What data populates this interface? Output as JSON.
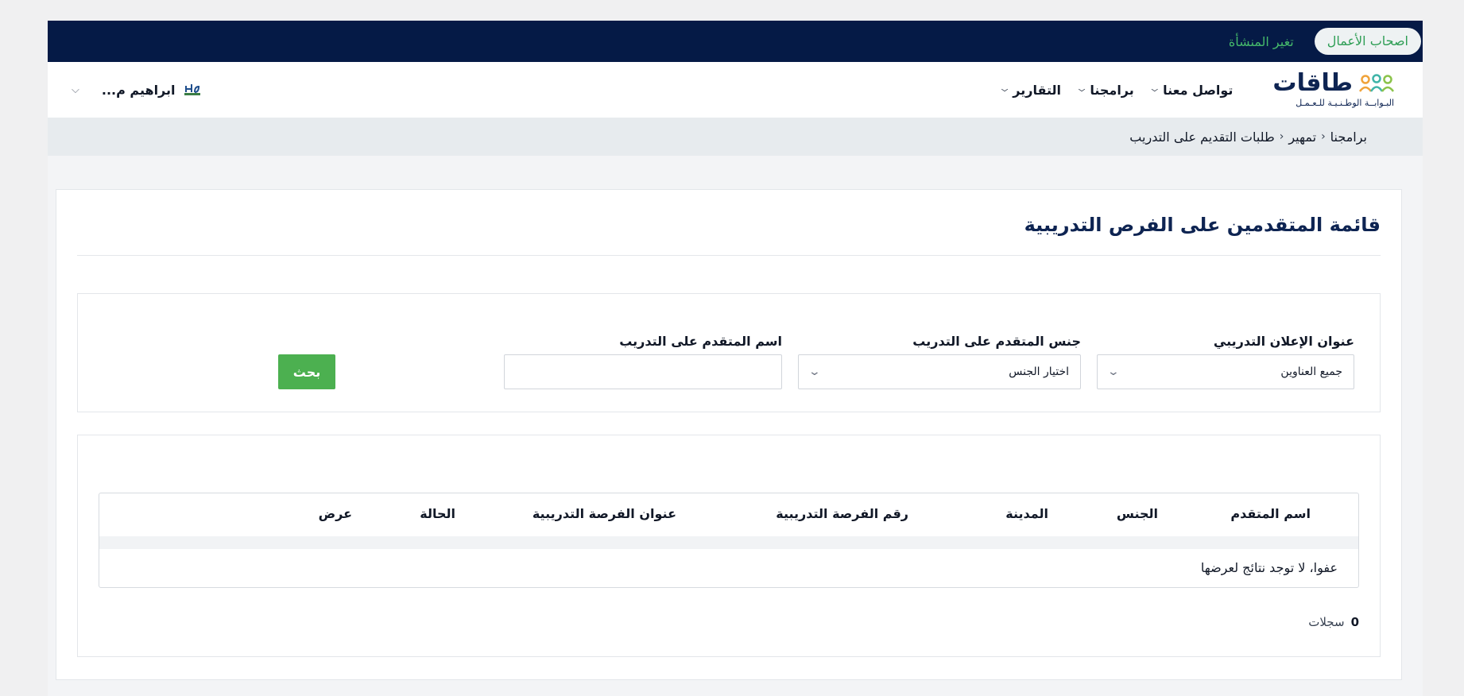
{
  "topbar": {
    "role_pill": "اصحاب الأعمال",
    "change_org": "تغير المنشأة"
  },
  "logo": {
    "word": "طاقات",
    "subtitle": "البـوابــة الوطـنـيـة للـعـمـل"
  },
  "nav": {
    "items": [
      {
        "label": "تواصل معنا"
      },
      {
        "label": "برامجنا"
      },
      {
        "label": "التقارير"
      }
    ],
    "user_name": "ابراهيم م..."
  },
  "breadcrumb": [
    "برامجنا",
    "تمهير",
    "طلبات التقديم على التدريب"
  ],
  "page": {
    "title": "قائمة المتقدمين على الفرص التدريبية"
  },
  "filters": {
    "ad_title_label": "عنوان الإعلان التدريبي",
    "ad_title_value": "جميع العناوين",
    "gender_label": "جنس المتقدم على التدريب",
    "gender_value": "اختيار الجنس",
    "name_label": "اسم المتقدم على التدريب",
    "name_value": "",
    "search_button": "بحث"
  },
  "table": {
    "columns": [
      "اسم المتقدم",
      "الجنس",
      "المدينة",
      "رقم الفرصة التدريبية",
      "عنوان الفرصة التدريبية",
      "الحالة",
      "عرض"
    ],
    "empty_message": "عفوا، لا توجد نتائج لعرضها"
  },
  "records": {
    "count": "0",
    "label": "سجلات"
  },
  "colors": {
    "topbar": "#051a46",
    "accent_green": "#4cb050",
    "title_navy": "#0e2452"
  }
}
